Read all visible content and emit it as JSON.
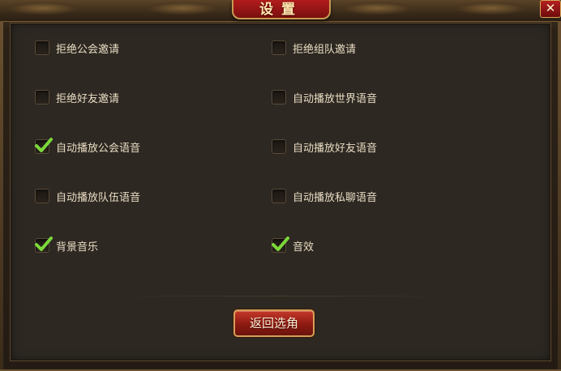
{
  "window": {
    "title": "设置",
    "close_label": "✕"
  },
  "options": [
    {
      "id": "reject-guild-invite",
      "label": "拒绝公会邀请",
      "checked": false
    },
    {
      "id": "reject-team-invite",
      "label": "拒绝组队邀请",
      "checked": false
    },
    {
      "id": "reject-friend-invite",
      "label": "拒绝好友邀请",
      "checked": false
    },
    {
      "id": "autoplay-world-voice",
      "label": "自动播放世界语音",
      "checked": false
    },
    {
      "id": "autoplay-guild-voice",
      "label": "自动播放公会语音",
      "checked": true
    },
    {
      "id": "autoplay-friend-voice",
      "label": "自动播放好友语音",
      "checked": false
    },
    {
      "id": "autoplay-team-voice",
      "label": "自动播放队伍语音",
      "checked": false
    },
    {
      "id": "autoplay-private-voice",
      "label": "自动播放私聊语音",
      "checked": false
    },
    {
      "id": "bg-music",
      "label": "背景音乐",
      "checked": true
    },
    {
      "id": "sound-effects",
      "label": "音效",
      "checked": true
    }
  ],
  "footer": {
    "return_label": "返回选角"
  },
  "colors": {
    "accent_red": "#8c1a12",
    "gold_border": "#d2a05a",
    "check_green": "#7bd83a",
    "text": "#e9dcc3"
  }
}
